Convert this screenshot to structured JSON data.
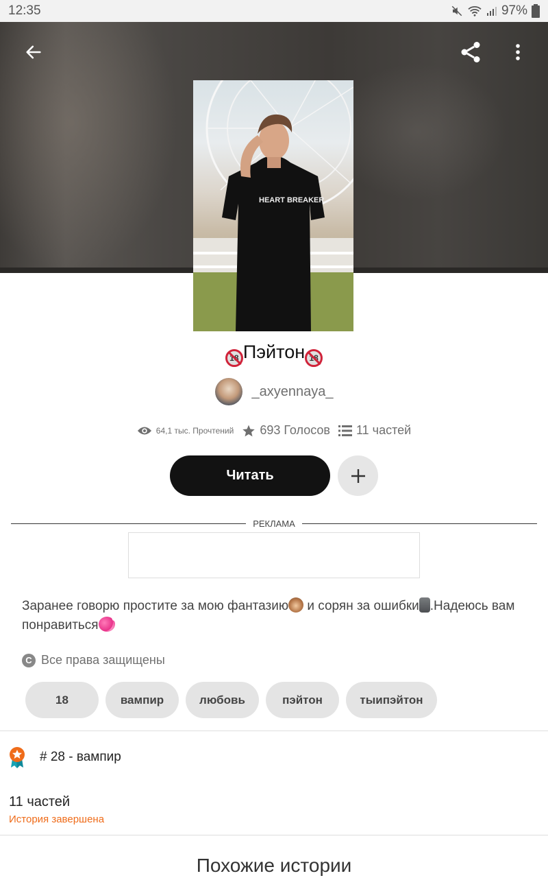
{
  "status_bar": {
    "time": "12:35",
    "battery": "97%"
  },
  "story": {
    "title": "Пэйтон",
    "title_emoji": "18",
    "author": "_axyennaya_",
    "reads": "64,1 тыс. Прочтений",
    "votes": "693 Голосов",
    "parts": "11 частей",
    "read_label": "Читать",
    "ad_label": "РЕКЛАМА",
    "description_1": "Заранее говорю простите за мою фантазию",
    "description_2": " и сорян за ошибки",
    "description_3": ".Надеюсь вам понравиться",
    "copyright_symbol": "C",
    "copyright": "Все права защищены",
    "tags": [
      "18",
      "вампир",
      "любовь",
      "пэйтон",
      "тыипэйтон"
    ],
    "rank": "# 28 - вампир",
    "parts_count": "11 частей",
    "status": "История завершена",
    "similar_title": "Похожие истории"
  },
  "colors": {
    "accent_orange": "#ef6c1a",
    "read_button": "#121212",
    "tag_bg": "#e4e4e4"
  },
  "icons": [
    "back-arrow-icon",
    "share-icon",
    "more-vert-icon",
    "eye-icon",
    "star-icon",
    "list-icon",
    "plus-icon",
    "copyright-icon",
    "rank-badge-icon"
  ]
}
